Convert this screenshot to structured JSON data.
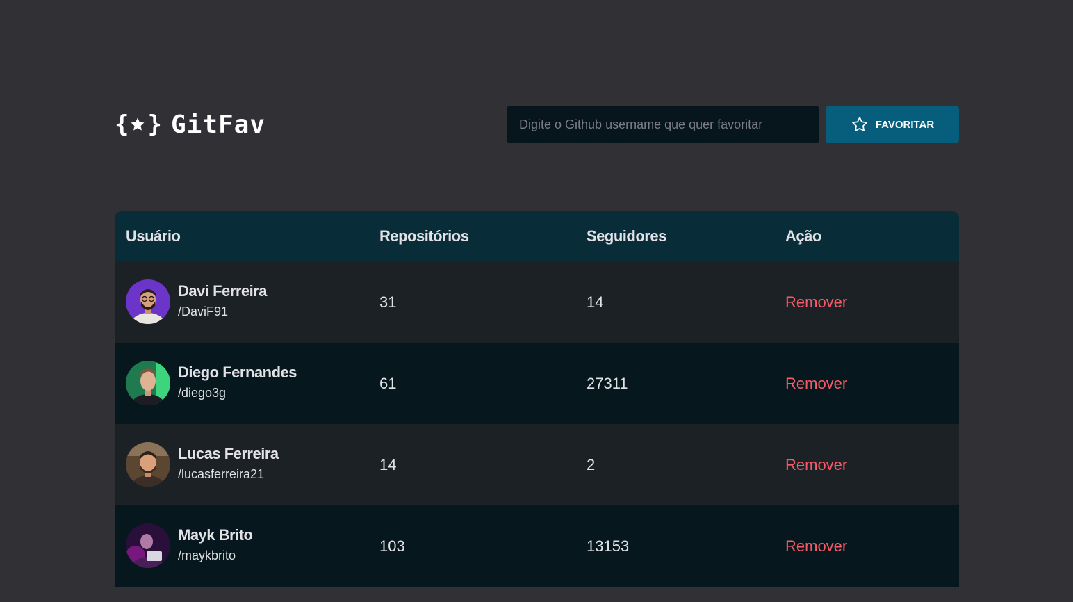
{
  "app": {
    "logo_text": "GitFav",
    "logo_icon": "star-braces-icon"
  },
  "search": {
    "placeholder": "Digite o Github username que quer favoritar",
    "value": ""
  },
  "favorite_button": {
    "label": "FAVORITAR",
    "icon": "star-outline-icon"
  },
  "table": {
    "headers": {
      "user": "Usuário",
      "repositories": "Repositórios",
      "followers": "Seguidores",
      "action": "Ação"
    },
    "rows": [
      {
        "name": "Davi Ferreira",
        "login": "/DaviF91",
        "repositories": "31",
        "followers": "14",
        "action": "Remover"
      },
      {
        "name": "Diego Fernandes",
        "login": "/diego3g",
        "repositories": "61",
        "followers": "27311",
        "action": "Remover"
      },
      {
        "name": "Lucas Ferreira",
        "login": "/lucasferreira21",
        "repositories": "14",
        "followers": "2",
        "action": "Remover"
      },
      {
        "name": "Mayk Brito",
        "login": "/maykbrito",
        "repositories": "103",
        "followers": "13153",
        "action": "Remover"
      }
    ]
  },
  "colors": {
    "background": "#303035",
    "button": "#065e7c",
    "table_header": "#092d38",
    "row_odd": "#1c2126",
    "row_even": "#06181d",
    "remove": "#f75a68"
  }
}
